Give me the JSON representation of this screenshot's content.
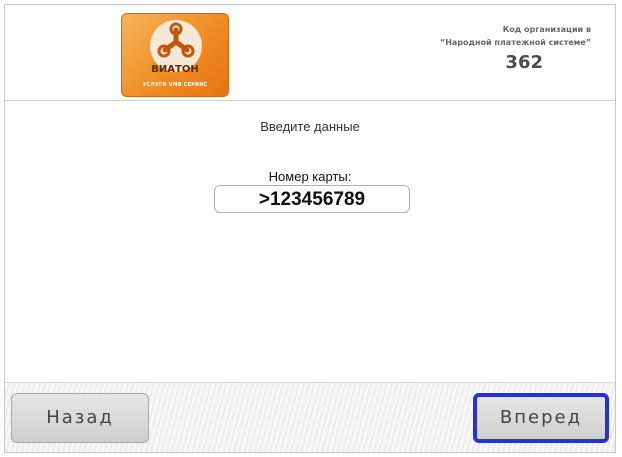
{
  "brand": {
    "name": "ВИАТОН",
    "tagline": "УСЛУГИ VMB СЕРВИС",
    "accent_color": "#ef8d23"
  },
  "organization": {
    "code_label_line1": "Код организации в",
    "code_label_line2": "“Народной платежной системе”",
    "code": "362"
  },
  "form": {
    "prompt": "Введите данные",
    "card_label": "Номер карты:",
    "card_value": ">123456789"
  },
  "nav": {
    "back_label": "Назад",
    "forward_label": "Вперед",
    "forward_highlight_color": "#2433d8"
  }
}
